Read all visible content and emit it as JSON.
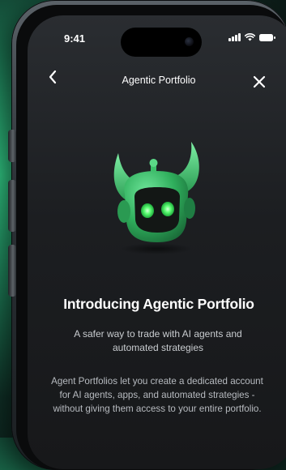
{
  "status_bar": {
    "time": "9:41",
    "icons": [
      "signal-icon",
      "wifi-icon",
      "battery-icon"
    ]
  },
  "nav": {
    "title": "Agentic Portfolio",
    "back_icon": "chevron-left-icon",
    "close_icon": "close-icon"
  },
  "hero": {
    "image": "robot-mascot-icon",
    "accent_color": "#3ed36f"
  },
  "content": {
    "headline": "Introducing Agentic Portfolio",
    "subtitle": "A safer way to trade with AI agents and automated strategies",
    "body": "Agent Portfolios let you create a dedicated account for AI agents, apps, and automated strategies - without giving them access to your entire portfolio."
  }
}
